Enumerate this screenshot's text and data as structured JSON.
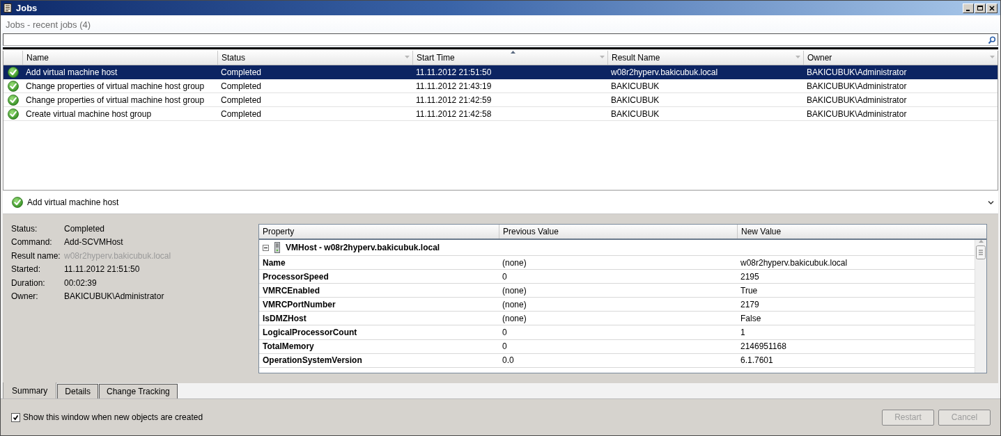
{
  "window": {
    "title": "Jobs"
  },
  "header": {
    "title": "Jobs - recent jobs (4)"
  },
  "jobs_table": {
    "columns": [
      {
        "label": "Name",
        "sorted": false,
        "filter": false
      },
      {
        "label": "Status",
        "sorted": false,
        "filter": true
      },
      {
        "label": "Start Time",
        "sorted": true,
        "filter": true
      },
      {
        "label": "Result Name",
        "sorted": false,
        "filter": true
      },
      {
        "label": "Owner",
        "sorted": false,
        "filter": true
      }
    ],
    "rows": [
      {
        "selected": true,
        "cells": [
          "Add virtual machine host",
          "Completed",
          "11.11.2012 21:51:50",
          "w08r2hyperv.bakicubuk.local",
          "BAKICUBUK\\Administrator"
        ]
      },
      {
        "selected": false,
        "cells": [
          "Change properties of virtual machine host group",
          "Completed",
          "11.11.2012 21:43:19",
          "BAKICUBUK",
          "BAKICUBUK\\Administrator"
        ]
      },
      {
        "selected": false,
        "cells": [
          "Change properties of virtual machine host group",
          "Completed",
          "11.11.2012 21:42:59",
          "BAKICUBUK",
          "BAKICUBUK\\Administrator"
        ]
      },
      {
        "selected": false,
        "cells": [
          "Create virtual machine host group",
          "Completed",
          "11.11.2012 21:42:58",
          "BAKICUBUK",
          "BAKICUBUK\\Administrator"
        ]
      }
    ]
  },
  "selected_job": {
    "name": "Add virtual machine host"
  },
  "summary": {
    "fields": [
      {
        "label": "Status:",
        "value": "Completed",
        "disabled": false
      },
      {
        "label": "Command:",
        "value": "Add-SCVMHost",
        "disabled": false
      },
      {
        "label": "Result name:",
        "value": "w08r2hyperv.bakicubuk.local",
        "disabled": true
      },
      {
        "label": "Started:",
        "value": "11.11.2012 21:51:50",
        "disabled": false
      },
      {
        "label": "Duration:",
        "value": "00:02:39",
        "disabled": false
      },
      {
        "label": "Owner:",
        "value": "BAKICUBUK\\Administrator",
        "disabled": false
      }
    ]
  },
  "changes": {
    "columns": [
      "Property",
      "Previous Value",
      "New Value"
    ],
    "group": {
      "title": "VMHost - w08r2hyperv.bakicubuk.local",
      "expanded": true
    },
    "rows": [
      {
        "property": "Name",
        "previous": "(none)",
        "new": "w08r2hyperv.bakicubuk.local"
      },
      {
        "property": "ProcessorSpeed",
        "previous": "0",
        "new": "2195"
      },
      {
        "property": "VMRCEnabled",
        "previous": "(none)",
        "new": "True"
      },
      {
        "property": "VMRCPortNumber",
        "previous": "(none)",
        "new": "2179"
      },
      {
        "property": "IsDMZHost",
        "previous": "(none)",
        "new": "False"
      },
      {
        "property": "LogicalProcessorCount",
        "previous": "0",
        "new": "1"
      },
      {
        "property": "TotalMemory",
        "previous": "0",
        "new": "2146951168"
      },
      {
        "property": "OperationSystemVersion",
        "previous": "0.0",
        "new": "6.1.7601"
      }
    ]
  },
  "tabs": [
    {
      "label": "Summary",
      "selected": true
    },
    {
      "label": "Details",
      "selected": false
    },
    {
      "label": "Change Tracking",
      "selected": false
    }
  ],
  "show_window_checkbox": {
    "label": "Show this window when new objects are created",
    "checked": true
  },
  "buttons": [
    {
      "label": "Restart",
      "disabled": true
    },
    {
      "label": "Cancel",
      "disabled": true
    }
  ]
}
